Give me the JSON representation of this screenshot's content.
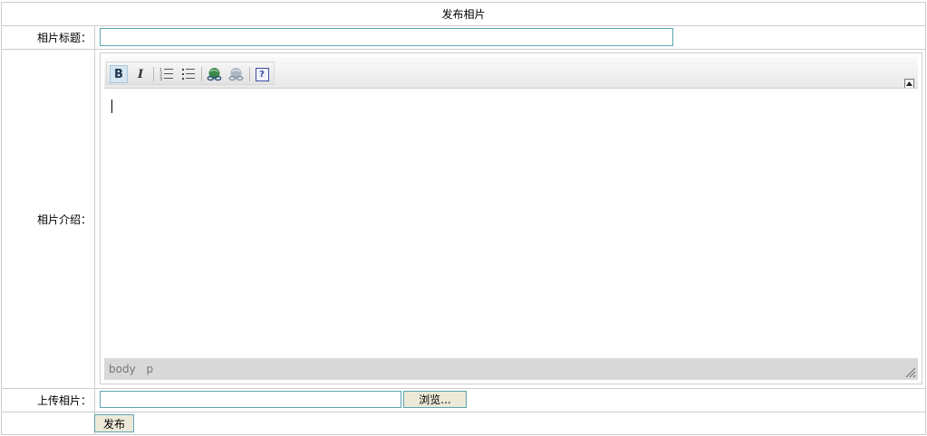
{
  "header": {
    "title": "发布相片"
  },
  "form": {
    "title_label": "相片标题：",
    "title_value": "",
    "intro_label": "相片介绍：",
    "upload_label": "上传相片：",
    "file_value": "",
    "browse_label": "浏览...",
    "submit_label": "发布"
  },
  "editor": {
    "toolbar": {
      "bold_glyph": "B",
      "italic_glyph": "I",
      "help_glyph": "?",
      "buttons": [
        "bold",
        "italic",
        "ordered-list",
        "unordered-list",
        "link",
        "unlink",
        "help"
      ]
    },
    "status_path": [
      "body",
      "p"
    ]
  },
  "colors": {
    "grid_border": "#cccccc",
    "input_border": "#5aa6b0",
    "button_bg": "#ece9d8",
    "status_bar_bg": "#d8d8d8"
  }
}
